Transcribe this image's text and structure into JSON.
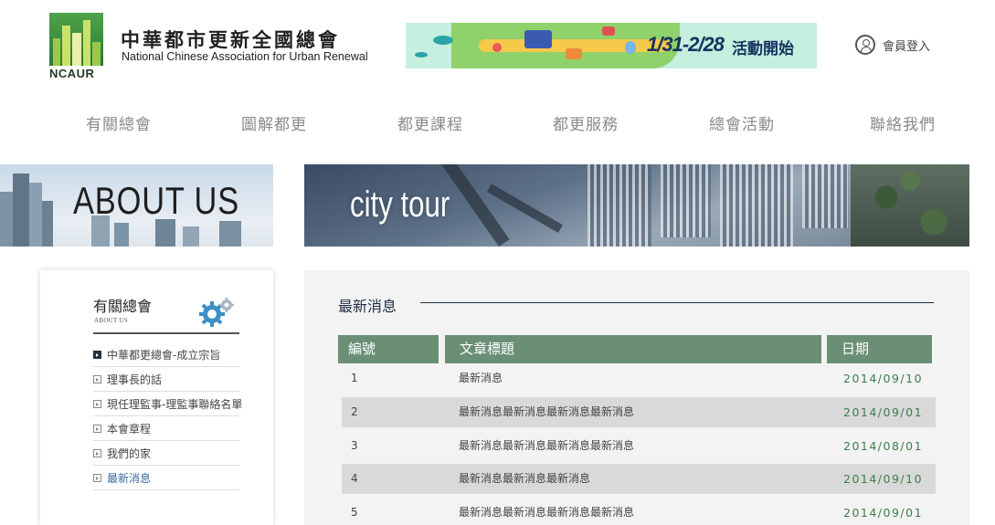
{
  "header": {
    "logo_text": "NCAUR",
    "org_name_zh": "中華都市更新全國總會",
    "org_name_en": "National Chinese Association for Urban Renewal",
    "promo_date": "1/31-2/28",
    "promo_text": "活動開始",
    "member_login_label": "會員登入"
  },
  "nav": {
    "items": [
      "有關總會",
      "圖解都更",
      "都更課程",
      "都更服務",
      "總會活動",
      "聯絡我們"
    ]
  },
  "hero": {
    "about_title": "ABOUT US",
    "city_title": "city tour"
  },
  "sidebar": {
    "title": "有關總會",
    "subtitle": "ABOUT US",
    "items": [
      {
        "label": "中華都更總會-成立宗旨",
        "state": "active"
      },
      {
        "label": "理事長的話",
        "state": ""
      },
      {
        "label": "現任理監事-理監事聯絡名單",
        "state": ""
      },
      {
        "label": "本會章程",
        "state": ""
      },
      {
        "label": "我們的家",
        "state": ""
      },
      {
        "label": "最新消息",
        "state": "current"
      }
    ]
  },
  "main": {
    "section_title": "最新消息",
    "columns": [
      "編號",
      "文章標題",
      "日期"
    ],
    "rows": [
      {
        "no": "1",
        "title": "最新消息",
        "date": "2014/09/10"
      },
      {
        "no": "2",
        "title": "最新消息最新消息最新消息最新消息",
        "date": "2014/09/01"
      },
      {
        "no": "3",
        "title": "最新消息最新消息最新消息最新消息",
        "date": "2014/08/01"
      },
      {
        "no": "4",
        "title": "最新消息最新消息最新消息",
        "date": "2014/09/10"
      },
      {
        "no": "5",
        "title": "最新消息最新消息最新消息最新消息",
        "date": "2014/09/01"
      }
    ]
  },
  "colors": {
    "table_header": "#6a8f75",
    "date_text": "#3d7d4d",
    "title_navy": "#1f2f44",
    "current_link": "#3a6b9c"
  }
}
